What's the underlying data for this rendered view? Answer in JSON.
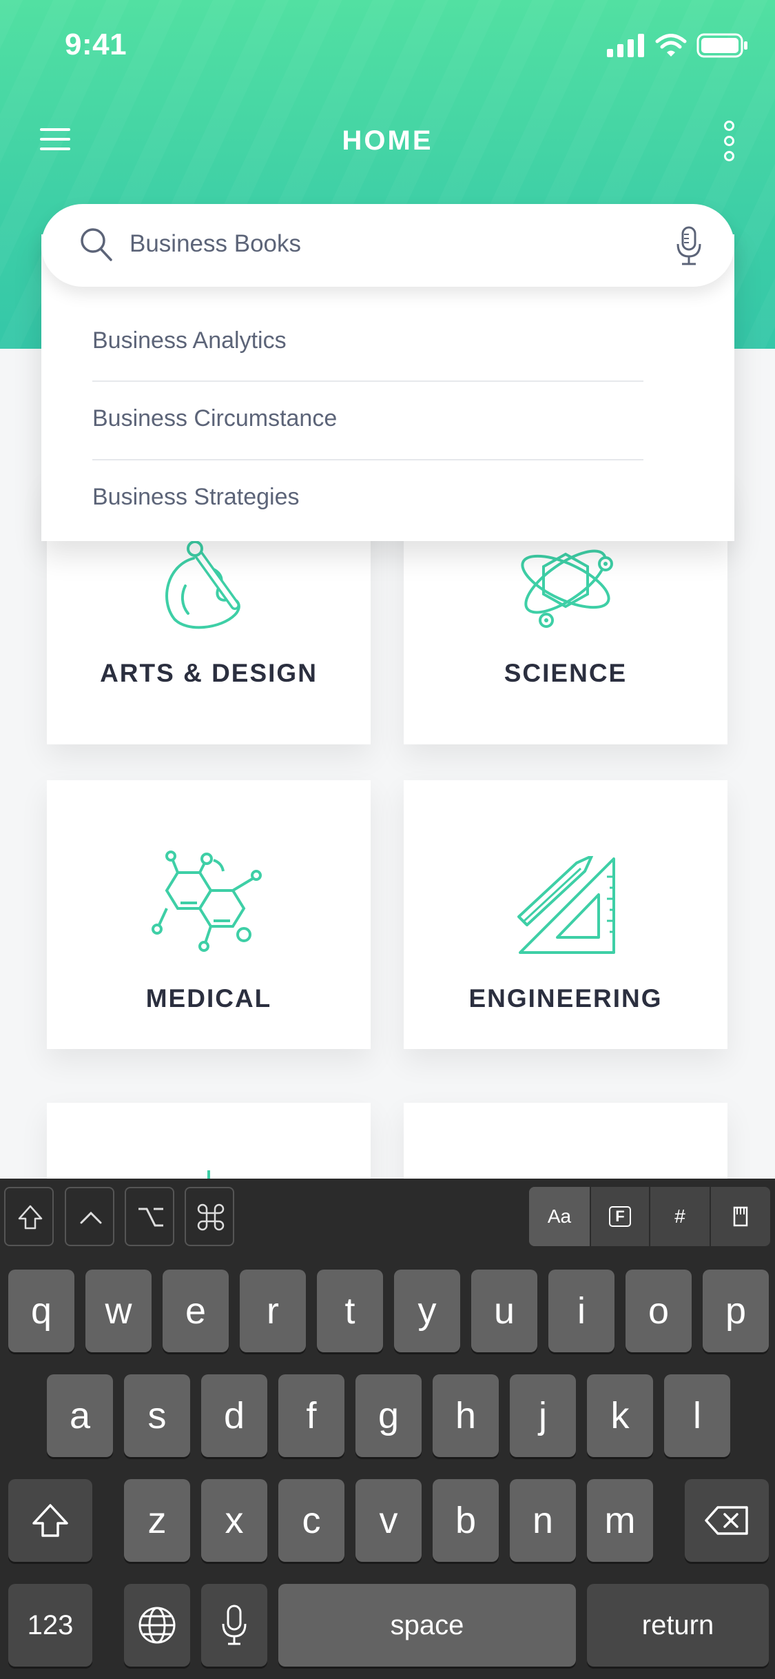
{
  "status_bar": {
    "time": "9:41"
  },
  "header": {
    "title": "HOME"
  },
  "search": {
    "value": "Business Books"
  },
  "suggestions": [
    "Business Analytics",
    "Business Circumstance",
    "Business Strategies"
  ],
  "categories": [
    {
      "label": "ARTS & DESIGN",
      "icon": "palette-icon"
    },
    {
      "label": "SCIENCE",
      "icon": "atom-icon"
    },
    {
      "label": "MEDICAL",
      "icon": "molecule-icon"
    },
    {
      "label": "ENGINEERING",
      "icon": "ruler-pencil-icon"
    }
  ],
  "colors": {
    "accent": "#3ecfa6",
    "accent_light": "#52e0a2",
    "text_dark": "#2b2f3f"
  },
  "keyboard": {
    "toolbar_right": [
      "Aa",
      "F",
      "#"
    ],
    "row1": [
      "q",
      "w",
      "e",
      "r",
      "t",
      "y",
      "u",
      "i",
      "o",
      "p"
    ],
    "row2": [
      "a",
      "s",
      "d",
      "f",
      "g",
      "h",
      "j",
      "k",
      "l"
    ],
    "row3": [
      "z",
      "x",
      "c",
      "v",
      "b",
      "n",
      "m"
    ],
    "numbers_label": "123",
    "space_label": "space",
    "return_label": "return"
  }
}
